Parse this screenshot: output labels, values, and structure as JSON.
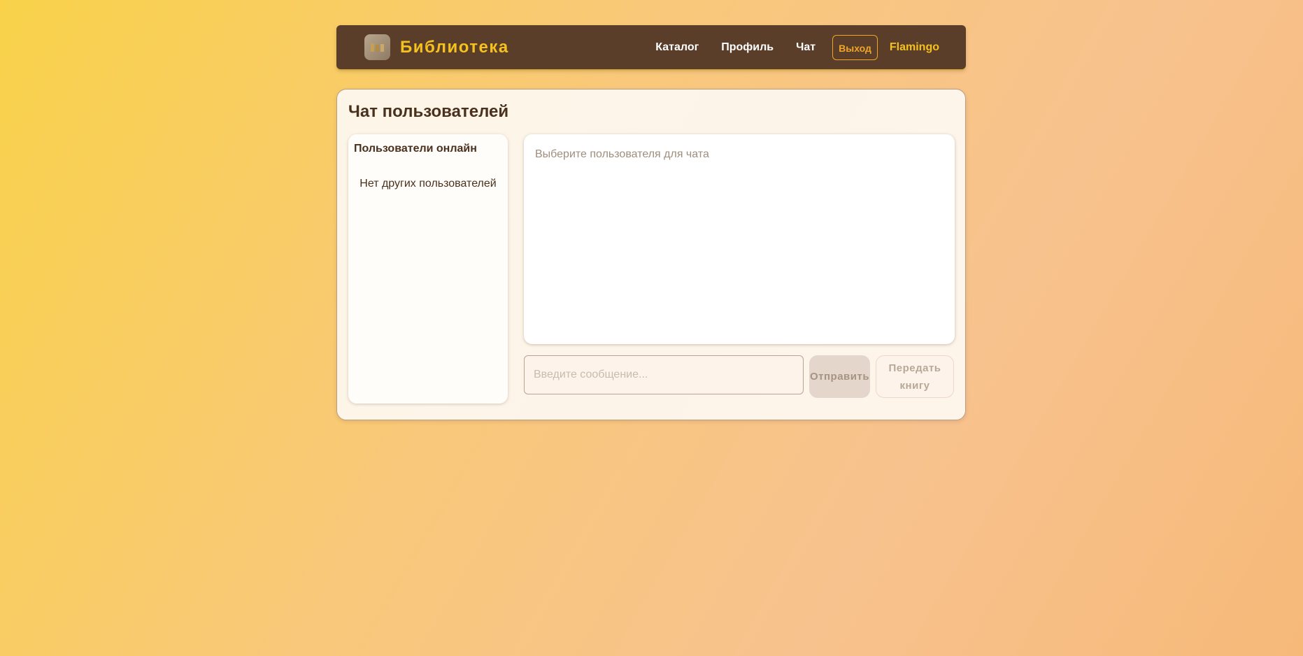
{
  "header": {
    "brand": "Библиотека",
    "logo_icon": "books-logo-icon",
    "nav": {
      "catalog": "Каталог",
      "profile": "Профиль",
      "chat": "Чат",
      "logout": "Выход",
      "username": "Flamingo"
    }
  },
  "chat": {
    "title": "Чат пользователей",
    "users_title": "Пользователи онлайн",
    "no_users": "Нет других пользователей",
    "messages_placeholder": "Выберите пользователя для чата",
    "input_placeholder": "Введите сообщение...",
    "send_label": "Отправить",
    "transfer_label": "Передать книгу"
  },
  "colors": {
    "navbar_bg": "#5a3e29",
    "brand": "#f5c11e",
    "logout_accent": "#f0a52a",
    "title_text": "#4a311d"
  }
}
